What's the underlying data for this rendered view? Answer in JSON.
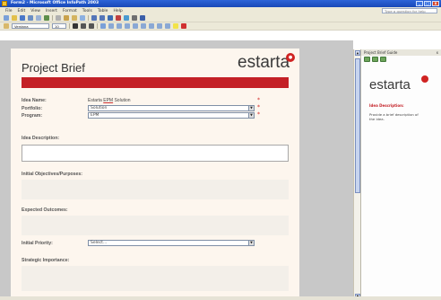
{
  "window": {
    "title": "Form2 - Microsoft Office InfoPath 2003"
  },
  "menu": {
    "items": [
      "File",
      "Edit",
      "View",
      "Insert",
      "Format",
      "Tools",
      "Table",
      "Help"
    ],
    "help_placeholder": "Type a question for help"
  },
  "format_toolbar": {
    "font_name": "Verdana",
    "font_size": "10"
  },
  "form": {
    "title": "Project Brief",
    "logo": "estarta",
    "fields": {
      "idea_name": {
        "label": "Idea Name:",
        "value_prefix": "Estarta",
        "value_marked": "EPM",
        "value_suffix": "Solution"
      },
      "portfolio": {
        "label": "Portfolio:",
        "value": "Solution"
      },
      "program": {
        "label": "Program:",
        "value": "EPM"
      },
      "idea_description": {
        "label": "Idea Description:"
      },
      "initial_objectives": {
        "label": "Initial Objectives/Purposes:"
      },
      "expected_outcomes": {
        "label": "Expected Outcomes:"
      },
      "initial_priority": {
        "label": "Initial Priority:",
        "value": "Select..."
      },
      "strategic_importance": {
        "label": "Strategic Importance:"
      }
    },
    "required_mark": "*"
  },
  "task_pane": {
    "title": "Project Brief Guide",
    "logo": "estarta",
    "section_label": "Idea Description:",
    "section_text": "Provide a brief description of the idea."
  },
  "colors": {
    "brand_red": "#c42026",
    "xp_blue": "#1848b8",
    "chrome": "#ece9d8"
  },
  "icons": [
    "app-icon",
    "minimize-icon",
    "maximize-icon",
    "close-icon",
    "dropdown-arrow-icon",
    "back-icon",
    "forward-icon",
    "home-icon"
  ]
}
